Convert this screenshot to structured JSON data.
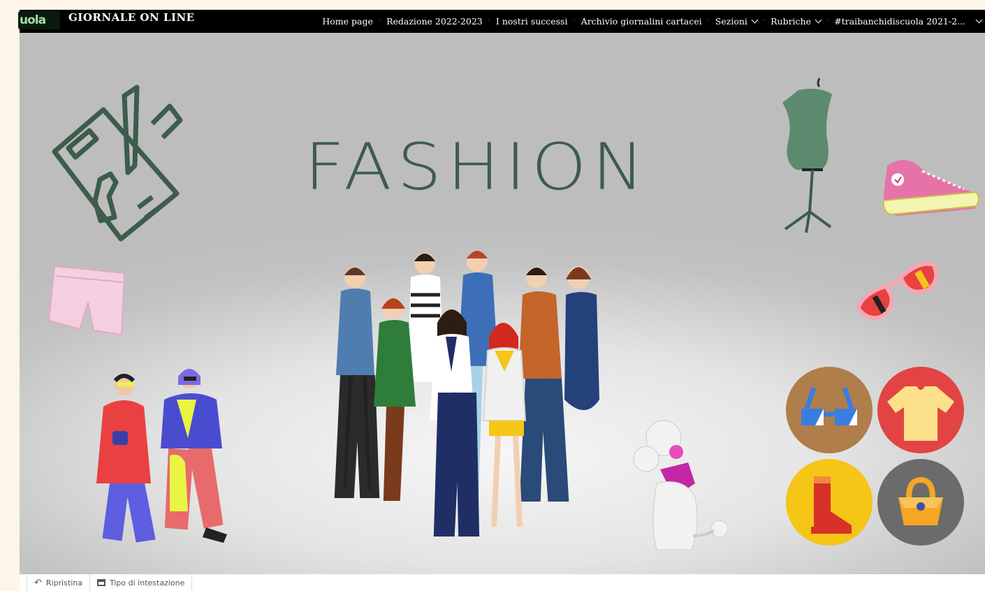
{
  "header": {
    "logo_text": "uola",
    "site_title": "GIORNALE ON LINE"
  },
  "nav": {
    "items": [
      {
        "label": "Home page",
        "dropdown": false
      },
      {
        "label": "Redazione 2022-2023",
        "dropdown": false
      },
      {
        "label": "I nostri successi",
        "dropdown": false
      },
      {
        "label": "Archivio giornalini cartacei",
        "dropdown": false
      },
      {
        "label": "Sezioni",
        "dropdown": true
      },
      {
        "label": "Rubriche",
        "dropdown": true
      },
      {
        "label": "#traibanchidiscuola 2021-2...",
        "dropdown": true
      }
    ]
  },
  "hero": {
    "headline": "FASHION",
    "icons": [
      "sketch-icon",
      "mannequin-icon",
      "sneaker-icon",
      "sunglasses-icon",
      "shorts-icon",
      "glasses-icon",
      "shirt-icon",
      "boot-icon",
      "handbag-icon",
      "poodle-icon"
    ]
  },
  "customizer": {
    "reset_label": "Ripristina",
    "header_type_label": "Tipo di intestazione"
  },
  "colors": {
    "title_green": "#3d5c4b",
    "nav_bg": "#000000",
    "circle_brown": "#b07e4a",
    "circle_red": "#e24444",
    "circle_yellow": "#f5c518",
    "circle_gray": "#6b6b6b"
  }
}
